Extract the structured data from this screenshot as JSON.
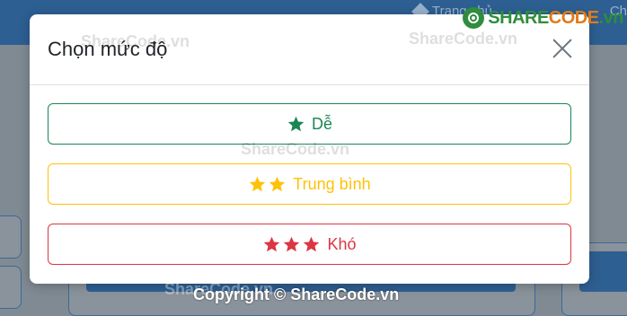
{
  "background": {
    "nav_home": "Trang chủ",
    "nav_other": "Ch"
  },
  "modal": {
    "title": "Chọn mức độ",
    "close_icon": "close-icon",
    "options": [
      {
        "label": "Dễ",
        "stars": 1,
        "color": "#198754",
        "icon": "star-icon"
      },
      {
        "label": "Trung bình",
        "stars": 2,
        "color": "#ffc107",
        "icon": "star-icon"
      },
      {
        "label": "Khó",
        "stars": 3,
        "color": "#dc3545",
        "icon": "star-icon"
      }
    ]
  },
  "watermark": {
    "logo_part1": "SHARE",
    "logo_part2": "CODE",
    "logo_part3": ".vn",
    "overlay_text": "ShareCode.vn",
    "footer": "Copyright © ShareCode.vn"
  }
}
